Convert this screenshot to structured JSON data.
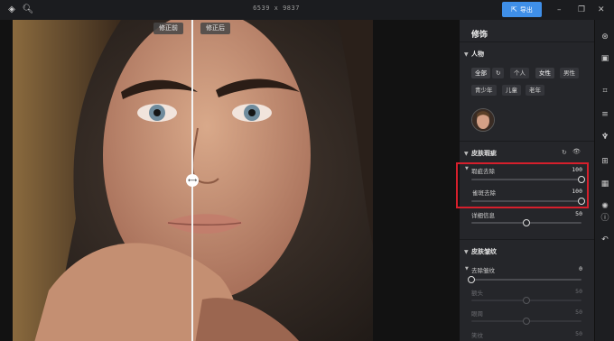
{
  "toolbar": {
    "dimensions": "6539 x 9837",
    "export_label": "导出"
  },
  "canvas": {
    "before_label": "修正前",
    "after_label": "修正后"
  },
  "panel": {
    "title": "修饰",
    "person": {
      "heading": "人物",
      "row1": [
        "全部",
        "个人",
        "女性",
        "男性"
      ],
      "row2": [
        "青少年",
        "儿童",
        "老年"
      ]
    },
    "skin_blemish": {
      "heading": "皮肤瑕疵",
      "sliders": [
        {
          "label": "瑕疵去除",
          "value": "100",
          "level": 1.0
        },
        {
          "label": "雀斑去除",
          "value": "100",
          "level": 1.0
        },
        {
          "label": "详细信息",
          "value": "50",
          "level": 0.5
        }
      ]
    },
    "skin_wrinkle": {
      "heading": "皮肤皱纹",
      "sliders": [
        {
          "label": "去除皱纹",
          "value": "0",
          "level": 0.0
        },
        {
          "label": "额头",
          "value": "50",
          "level": 0.5
        },
        {
          "label": "眼周",
          "value": "50",
          "level": 0.5
        },
        {
          "label": "笑纹",
          "value": "50",
          "level": 0.5
        }
      ]
    }
  },
  "colors": {
    "accent": "#3f8fe8",
    "highlight_box": "#d61f2c"
  }
}
